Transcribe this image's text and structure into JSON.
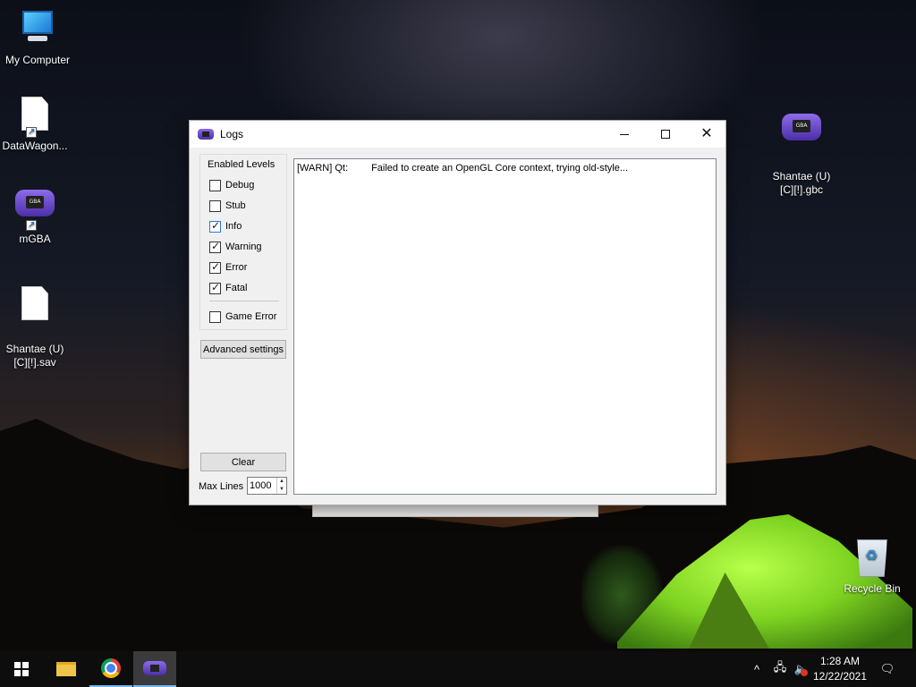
{
  "desktop": {
    "icons": [
      {
        "label": "My Computer"
      },
      {
        "label": "DataWagon..."
      },
      {
        "label": "mGBA"
      },
      {
        "label": "Shantae (U)\n[C][!].sav"
      },
      {
        "label": "Shantae (U)\n[C][!].gbc"
      },
      {
        "label": "Recycle Bin"
      }
    ]
  },
  "window": {
    "title": "Logs",
    "enabled_levels_title": "Enabled Levels",
    "levels": [
      {
        "label": "Debug",
        "checked": false
      },
      {
        "label": "Stub",
        "checked": false
      },
      {
        "label": "Info",
        "checked": true
      },
      {
        "label": "Warning",
        "checked": true
      },
      {
        "label": "Error",
        "checked": true
      },
      {
        "label": "Fatal",
        "checked": true
      },
      {
        "label": "Game Error",
        "checked": false
      }
    ],
    "advanced_settings_label": "Advanced settings",
    "clear_label": "Clear",
    "max_lines_label": "Max Lines",
    "max_lines_value": "1000",
    "log_entries": [
      {
        "level": "[WARN] Qt:",
        "message": "Failed to create an OpenGL Core context, trying old-style..."
      }
    ]
  },
  "taskbar": {
    "time": "1:28 AM",
    "date": "12/22/2021",
    "tray_chevron": "^"
  },
  "icons": [
    "windows-icon",
    "file-explorer-icon",
    "chrome-icon",
    "mgba-icon",
    "network-icon",
    "volume-muted-icon",
    "notification-icon"
  ]
}
